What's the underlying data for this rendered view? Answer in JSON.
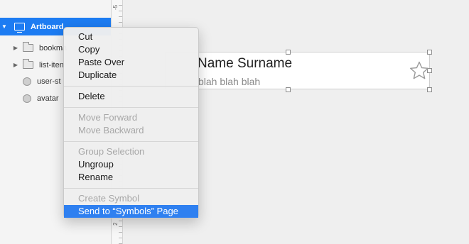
{
  "layers": {
    "items": [
      {
        "label": "Artboard",
        "type": "artboard",
        "icon": "artboard-icon",
        "selected": true
      },
      {
        "label": "bookma",
        "type": "group",
        "icon": "folder-icon"
      },
      {
        "label": "list-iten",
        "type": "group",
        "icon": "folder-icon"
      },
      {
        "label": "user-st",
        "type": "shape",
        "icon": "oval-icon"
      },
      {
        "label": "avatar",
        "type": "shape",
        "icon": "oval-icon"
      }
    ]
  },
  "ruler": {
    "labels": [
      "-5",
      "2"
    ]
  },
  "card": {
    "name": "Name Surname",
    "subtitle": "blah blah blah",
    "icon": "star-outline-icon"
  },
  "context_menu": {
    "groups": [
      [
        {
          "label": "Cut",
          "enabled": true
        },
        {
          "label": "Copy",
          "enabled": true
        },
        {
          "label": "Paste Over",
          "enabled": true
        },
        {
          "label": "Duplicate",
          "enabled": true
        }
      ],
      [
        {
          "label": "Delete",
          "enabled": true
        }
      ],
      [
        {
          "label": "Move Forward",
          "enabled": false
        },
        {
          "label": "Move Backward",
          "enabled": false
        }
      ],
      [
        {
          "label": "Group Selection",
          "enabled": false
        },
        {
          "label": "Ungroup",
          "enabled": true
        },
        {
          "label": "Rename",
          "enabled": true
        }
      ],
      [
        {
          "label": "Create Symbol",
          "enabled": false
        },
        {
          "label": "Send to “Symbols” Page",
          "enabled": true,
          "highlighted": true
        }
      ]
    ]
  },
  "colors": {
    "selection": "#1d7cf2",
    "menu_highlight": "#2f80f0",
    "disabled_text": "#a7a7a7"
  }
}
